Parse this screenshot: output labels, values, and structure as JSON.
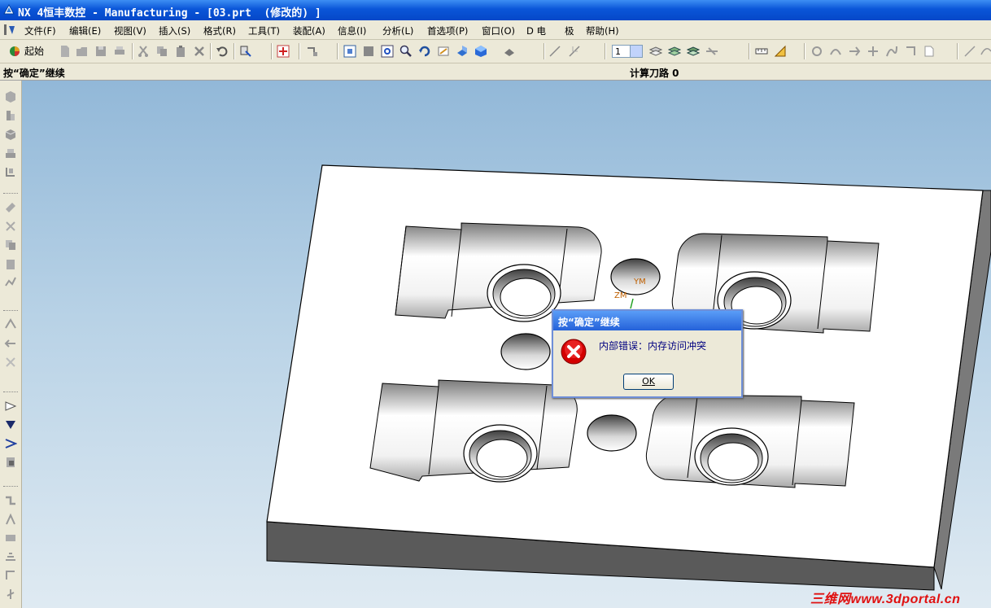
{
  "window": {
    "title": "NX 4恒丰数控 - Manufacturing - [03.prt  (修改的) ]"
  },
  "menu": {
    "items": [
      {
        "label": "文件(F)"
      },
      {
        "label": "编辑(E)"
      },
      {
        "label": "视图(V)"
      },
      {
        "label": "插入(S)"
      },
      {
        "label": "格式(R)"
      },
      {
        "label": "工具(T)"
      },
      {
        "label": "装配(A)"
      },
      {
        "label": "信息(I)"
      },
      {
        "label": "分析(L)"
      },
      {
        "label": "首选项(P)"
      },
      {
        "label": "窗口(O)"
      },
      {
        "label": "D 电"
      },
      {
        "label": "极"
      },
      {
        "label": "帮助(H)"
      }
    ]
  },
  "toolbar": {
    "start_label": "起始",
    "layer_value": "1"
  },
  "status": {
    "cue": "按“确定”继续",
    "text": "计算刀路 0"
  },
  "triad": {
    "ym": "YM",
    "zm": "ZM"
  },
  "dialog": {
    "title": "按“确定”继续",
    "message": "内部错误：内存访问冲突",
    "ok_label": "OK"
  },
  "watermark": "三维网www.3dportal.cn",
  "colors": {
    "titlebar": "#0a55d8",
    "viewport_top": "#92b8d8",
    "error_red": "#d40000"
  }
}
